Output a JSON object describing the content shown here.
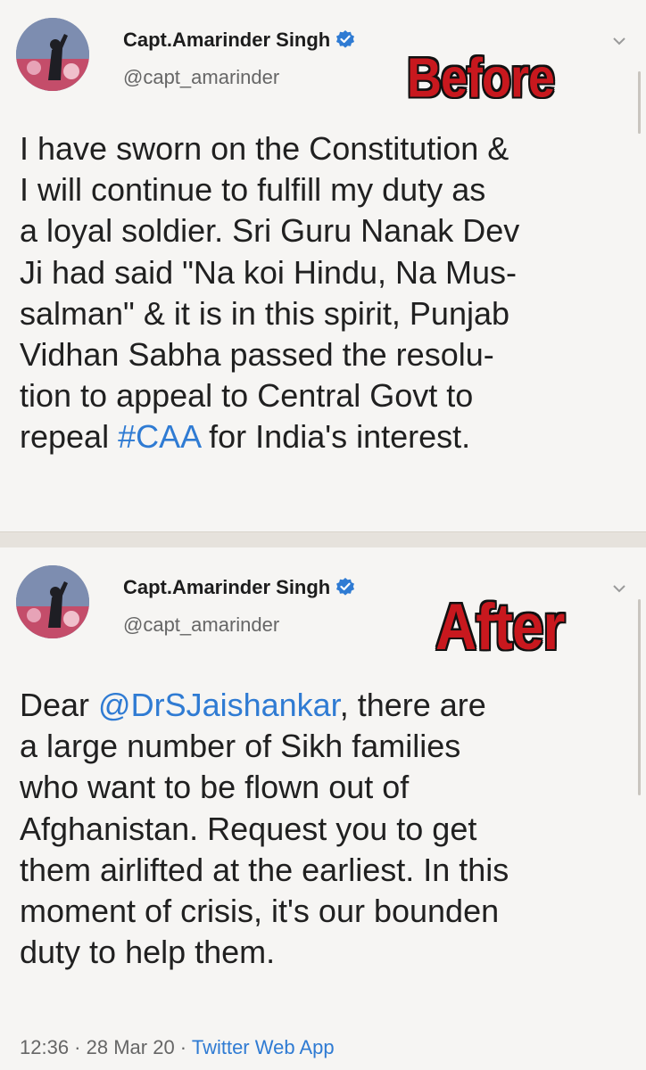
{
  "tweets": [
    {
      "author_name": "Capt.Amarinder Singh",
      "handle": "@capt_amarinder",
      "overlay_label": "Before",
      "lines": [
        [
          {
            "t": "I have sworn on the Constitution &"
          }
        ],
        [
          {
            "t": "I will continue to fulfill my duty as"
          }
        ],
        [
          {
            "t": "a loyal soldier. Sri Guru Nanak Dev"
          }
        ],
        [
          {
            "t": "Ji had said \"Na koi Hindu, Na Mus-"
          }
        ],
        [
          {
            "t": "salman\" & it is in this spirit, Punjab"
          }
        ],
        [
          {
            "t": "Vidhan Sabha passed the resolu-"
          }
        ],
        [
          {
            "t": "tion to appeal to Central Govt to"
          }
        ],
        [
          {
            "t": "repeal "
          },
          {
            "t": "#CAA",
            "link": true
          },
          {
            "t": " for India's interest."
          }
        ]
      ]
    },
    {
      "author_name": "Capt.Amarinder Singh",
      "handle": "@capt_amarinder",
      "overlay_label": "After",
      "lines": [
        [
          {
            "t": "Dear "
          },
          {
            "t": "@DrSJaishankar",
            "link": true
          },
          {
            "t": ", there are"
          }
        ],
        [
          {
            "t": "a large number of Sikh families"
          }
        ],
        [
          {
            "t": "who want to be flown out of"
          }
        ],
        [
          {
            "t": "Afghanistan. Request you to get"
          }
        ],
        [
          {
            "t": "them airlifted at the earliest. In this"
          }
        ],
        [
          {
            "t": "moment of crisis, it's our bounden"
          }
        ],
        [
          {
            "t": "duty to help them."
          }
        ]
      ],
      "meta": {
        "time": "12:36",
        "sep": " · ",
        "date": "28 Mar 20",
        "app": "Twitter Web App"
      }
    }
  ],
  "colors": {
    "link": "#2f7bd3",
    "verified": "#2f7bd3",
    "overlay_text": "#c8181e"
  },
  "icons": [
    "avatar",
    "verified-badge-icon",
    "chevron-down-icon"
  ]
}
